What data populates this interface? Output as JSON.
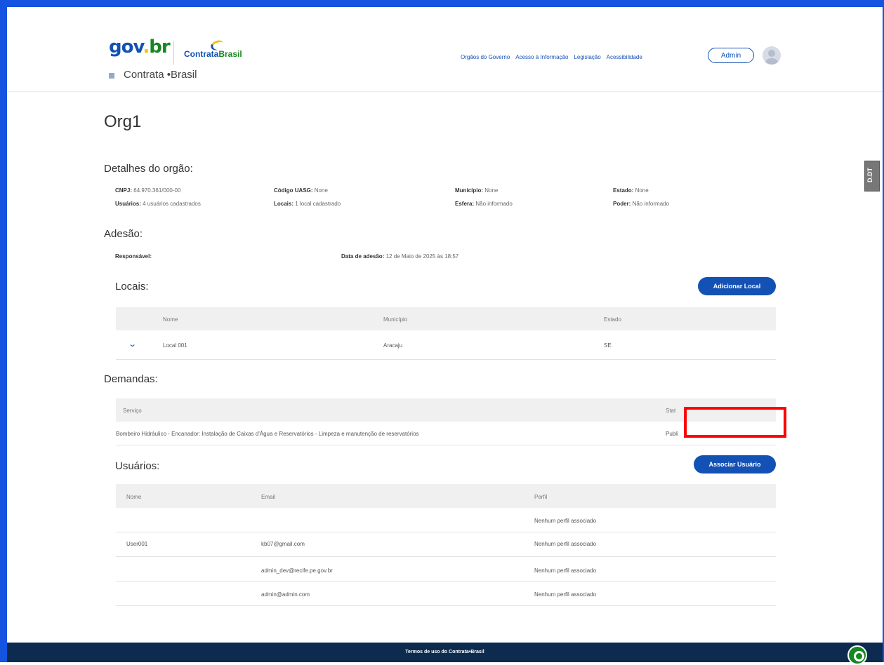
{
  "header": {
    "logo": {
      "gov_a": "gov",
      "gov_b": ".",
      "gov_c": "br",
      "contrata_a": "Contrata",
      "contrata_b": "Brasil"
    },
    "app_name": "Contrata •Brasil",
    "nav": [
      "Orgãos do Governo",
      "Acesso à Informação",
      "Legislação",
      "Acessibilidade"
    ],
    "user_button": "Admin"
  },
  "page_title": "Org1",
  "side_tab": "D.DT",
  "details": {
    "heading": "Detalhes do orgão:",
    "fields": [
      {
        "label": "CNPJ:",
        "value": " 64.970.361/000-00"
      },
      {
        "label": "Código UASG:",
        "value": " None"
      },
      {
        "label": "Município:",
        "value": " None"
      },
      {
        "label": "Estado:",
        "value": " None"
      },
      {
        "label": "Usuários:",
        "value": " 4 usuários cadastrados"
      },
      {
        "label": "Locais:",
        "value": " 1 local cadastrado"
      },
      {
        "label": "Esfera:",
        "value": " Não informado"
      },
      {
        "label": "Poder:",
        "value": " Não informado"
      }
    ]
  },
  "adesao": {
    "heading": "Adesão:",
    "responsavel_label": "Responsável:",
    "data_label": "Data de adesão:",
    "data_value": " 12 de Maio de 2025 às 18:57"
  },
  "locais": {
    "heading": "Locais:",
    "add_button": "Adicionar Local",
    "columns": [
      "Nome",
      "Município",
      "Estado"
    ],
    "rows": [
      [
        "Local 001",
        "Aracaju",
        "SE"
      ]
    ]
  },
  "demandas": {
    "heading": "Demandas:",
    "columns": [
      "Serviço",
      "Stat"
    ],
    "rows": [
      [
        "Bombeiro Hidráulico - Encanador: Instalação de Caixas d'Água e Reservatórios - Limpeza e manutenção de reservatórios",
        "Publi"
      ]
    ]
  },
  "usuarios": {
    "heading": "Usuários:",
    "associate_button": "Associar Usuário",
    "columns": [
      "Nome",
      "Email",
      "Perfil"
    ],
    "rows": [
      [
        "",
        "",
        "Nenhum perfil associado"
      ],
      [
        "User001",
        "kb07@gmail.com",
        "Nenhum perfil associado"
      ],
      [
        "",
        "admin_dev@recife.pe.gov.br",
        "Nenhum perfil associado"
      ],
      [
        "",
        "admin@admin.com",
        "Nenhum perfil associado"
      ]
    ]
  },
  "footer": {
    "text": "Termos de uso do Contrata•Brasil"
  },
  "colors": {
    "primary": "#1351b4",
    "footer": "#0c2b4e",
    "highlight": "#ff0000",
    "frame": "#1454e0"
  }
}
